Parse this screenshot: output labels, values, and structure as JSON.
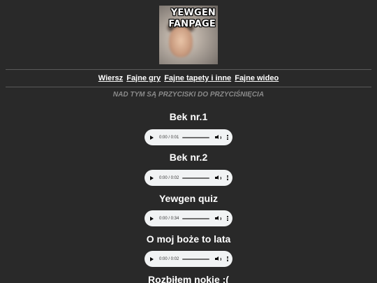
{
  "logo": {
    "line1": "YEWGEN",
    "line2": "FANPAGE"
  },
  "nav": [
    "Wiersz",
    "Fajne gry",
    "Fajne tapety i inne",
    "Fajne wideo"
  ],
  "notice": "NAD TYM SĄ PRZYCISKI DO PRZYCIŚNIĘCIA",
  "tracks": [
    {
      "title": "Bek nr.1",
      "time": "0:00 / 0:01",
      "progress": 0
    },
    {
      "title": "Bek nr.2",
      "time": "0:00 / 0:02",
      "progress": 0
    },
    {
      "title": "Yewgen quiz",
      "time": "0:00 / 0:34",
      "progress": 0
    },
    {
      "title": "O moj boże to lata",
      "time": "0:00 / 0:02",
      "progress": 0
    },
    {
      "title": "Rozbiłem nokie :(",
      "time": "",
      "progress": 0
    }
  ]
}
